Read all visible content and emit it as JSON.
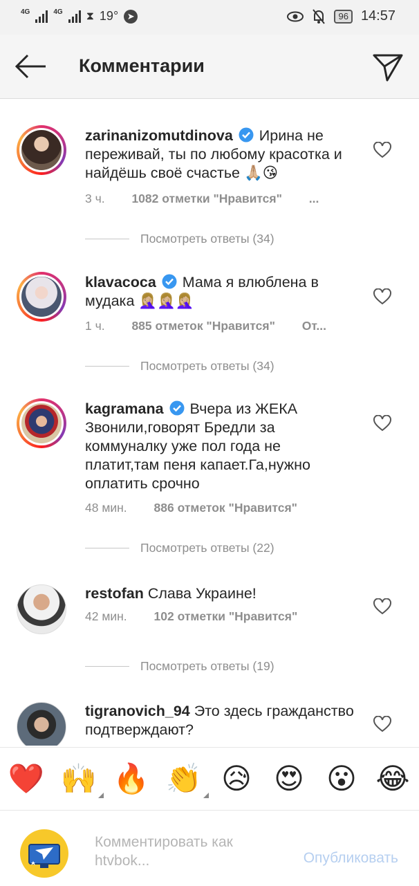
{
  "status_bar": {
    "network1": "4G",
    "network2": "4G",
    "temperature": "19°",
    "battery": "96",
    "time": "14:57"
  },
  "header": {
    "title": "Комментарии",
    "back_icon": "arrow-left-icon",
    "send_icon": "direct-send-icon"
  },
  "comments": [
    {
      "username": "zarinanizomutdinova",
      "verified": true,
      "text": "Ирина не переживай, ты по любому красотка и найдёшь своё счастье 🙏🏼😘",
      "time": "3 ч.",
      "likes": "1082 отметки \"Нравится\"",
      "extra": "...",
      "replies": "Посмотреть ответы (34)"
    },
    {
      "username": "klavacoca",
      "verified": true,
      "text": "Мама я влюблена в мудака 🤦🏼‍♀️🤦🏼‍♀️🤦🏼‍♀️",
      "time": "1 ч.",
      "likes": "885 отметок \"Нравится\"",
      "extra": "От...",
      "replies": "Посмотреть ответы (34)"
    },
    {
      "username": "kagramana",
      "verified": true,
      "text": "Вчера из ЖЕКА Звонили,говорят Бредли за коммуналку уже пол года не платит,там пеня капает.Га,нужно оплатить срочно",
      "time": "48 мин.",
      "likes": "886 отметок \"Нравится\"",
      "replies": "Посмотреть ответы (22)"
    },
    {
      "username": "restofan",
      "verified": false,
      "text": "Слава Украине!",
      "time": "42 мин.",
      "likes": "102 отметки \"Нравится\"",
      "replies": "Посмотреть ответы (19)"
    },
    {
      "username": "tigranovich_94",
      "verified": false,
      "text": "Это здесь гражданство подтверждают?"
    }
  ],
  "emoji_bar": [
    "❤️",
    "🙌",
    "🔥",
    "👏",
    "😥",
    "😍",
    "😮",
    "😂"
  ],
  "input": {
    "placeholder": "Комментировать как htvbok...",
    "publish": "Опубликовать"
  }
}
